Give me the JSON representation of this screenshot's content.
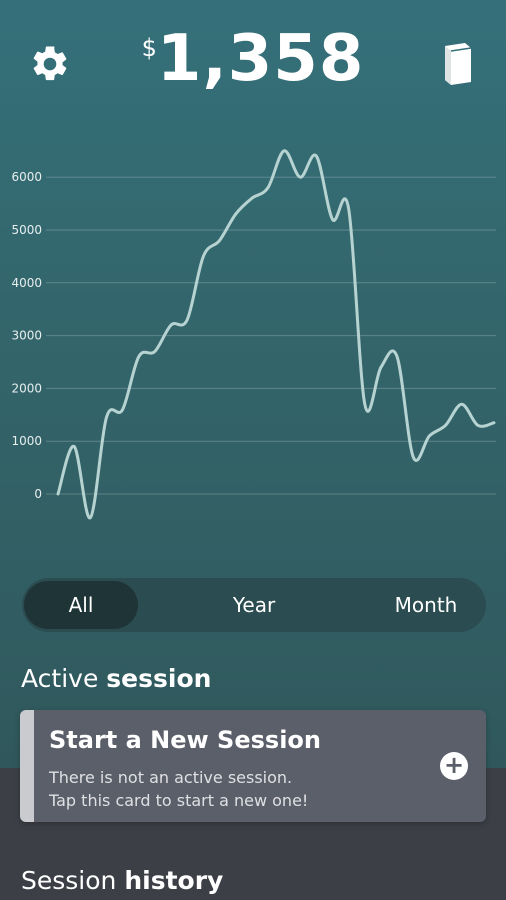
{
  "header": {
    "currency_symbol": "$",
    "balance": "1,358",
    "settings_icon": "gear-icon",
    "history_icon": "book-icon"
  },
  "chart_data": {
    "type": "line",
    "y_ticks": [
      "0",
      "1000",
      "2000",
      "3000",
      "4000",
      "5000",
      "6000"
    ],
    "ylim": [
      -500,
      6500
    ],
    "grid": true,
    "series": [
      {
        "values": [
          0,
          900,
          -450,
          1450,
          1600,
          2600,
          2700,
          3200,
          3300,
          4500,
          4800,
          5300,
          5600,
          5800,
          6500,
          6000,
          6400,
          5200,
          5400,
          1700,
          2400,
          2600,
          700,
          1100,
          1300,
          1700,
          1300,
          1350
        ],
        "color": "#b6d3d2"
      }
    ]
  },
  "range_toggle": {
    "options": [
      "All",
      "Year",
      "Month"
    ],
    "selected": "All"
  },
  "active_session": {
    "title_light": "Active",
    "title_bold": "session",
    "card_title": "Start a New Session",
    "card_line1": "There is not an active session.",
    "card_line2": "Tap this card to start a new one!",
    "card_action_icon": "plus-icon"
  },
  "session_history": {
    "title_light": "Session",
    "title_bold": "history"
  },
  "colors": {
    "top_bg": "#33666c",
    "bottom_bg": "#3d3f47",
    "card_bg": "#5b5f6a",
    "line": "#b6d3d2"
  }
}
